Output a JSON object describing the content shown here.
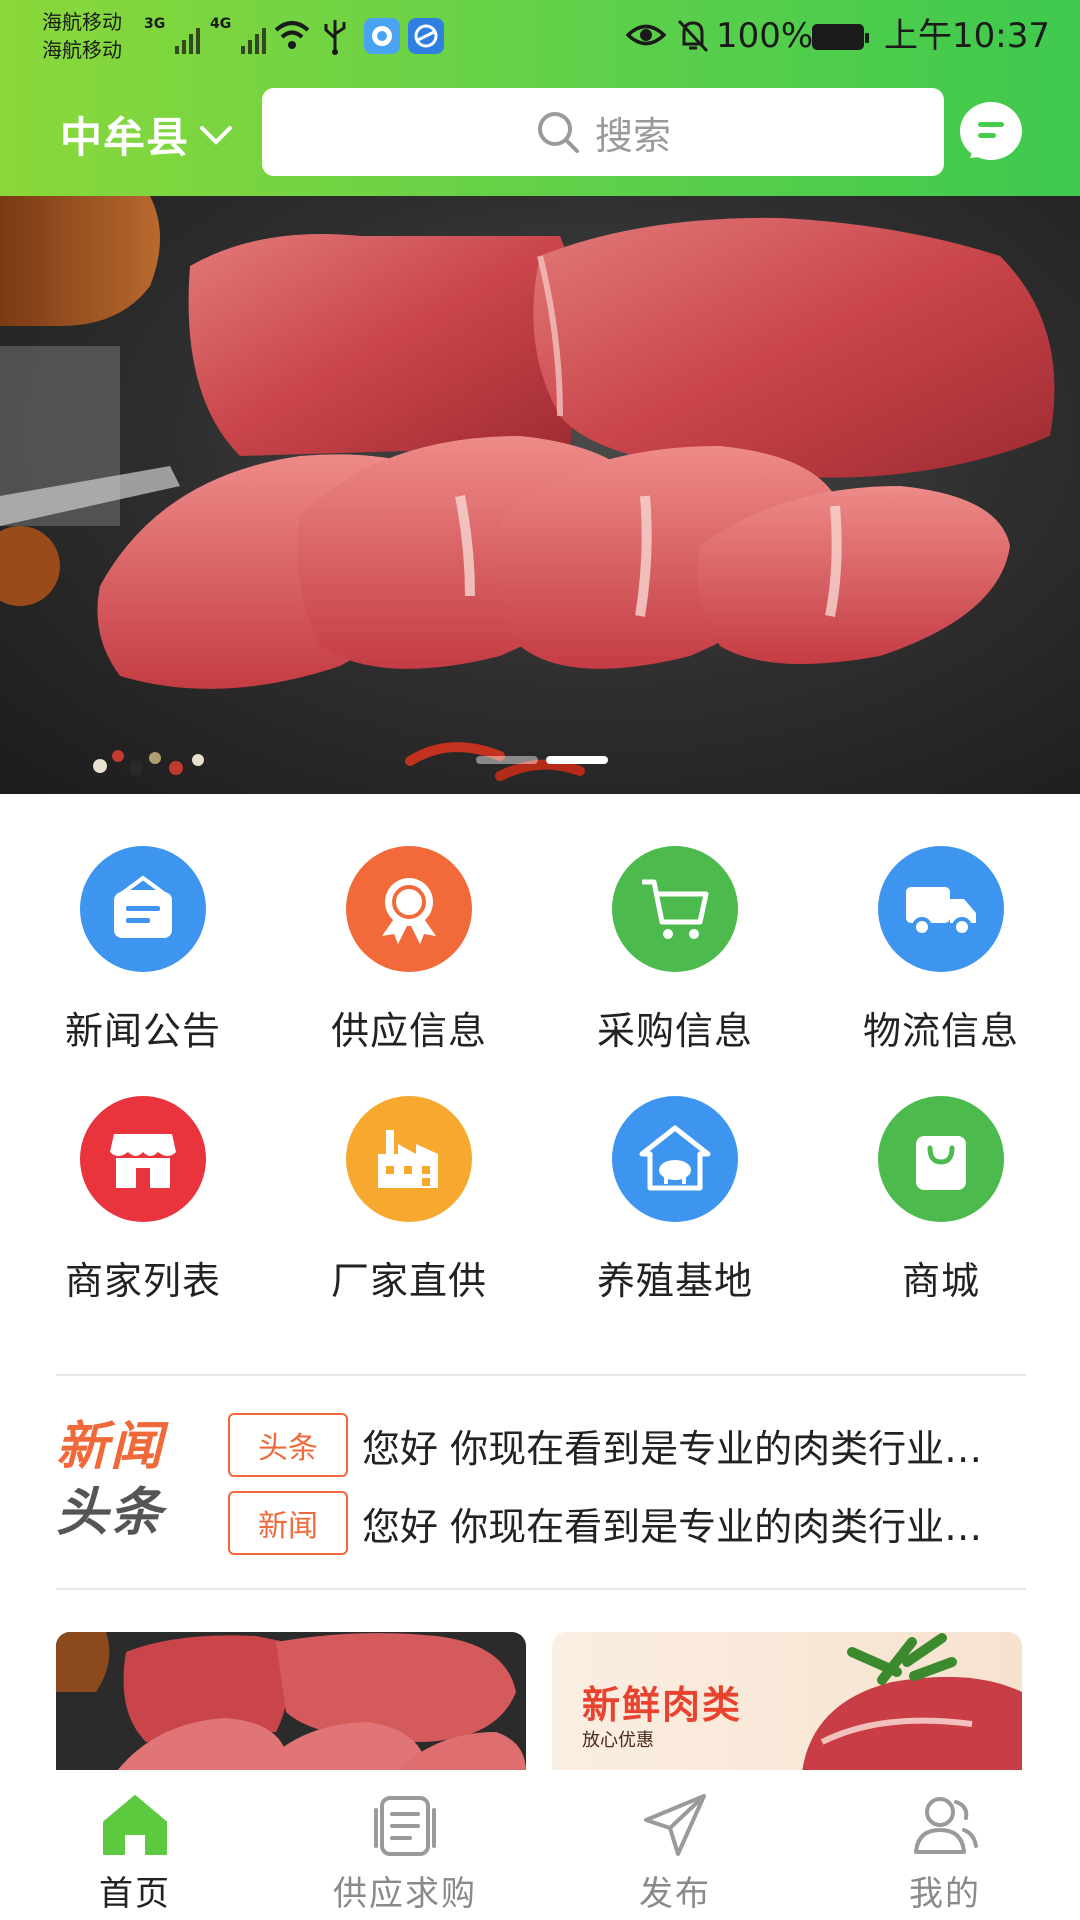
{
  "status_bar": {
    "carrier_1": "海航移动",
    "carrier_2": "海航移动",
    "network_1": "3G",
    "network_2": "4G",
    "battery": "100%",
    "time": "上午10:37"
  },
  "header": {
    "location": "中牟县",
    "search_placeholder": "搜索"
  },
  "banner": {
    "slide_count": 2,
    "active_slide": 2
  },
  "categories": [
    {
      "label": "新闻公告",
      "icon": "news-bag-icon",
      "color": "#3e95f0"
    },
    {
      "label": "供应信息",
      "icon": "award-ribbon-icon",
      "color": "#f26a3a"
    },
    {
      "label": "采购信息",
      "icon": "shopping-cart-icon",
      "color": "#4dba4e"
    },
    {
      "label": "物流信息",
      "icon": "delivery-truck-icon",
      "color": "#3e95f0"
    },
    {
      "label": "商家列表",
      "icon": "storefront-icon",
      "color": "#e9333d"
    },
    {
      "label": "厂家直供",
      "icon": "factory-icon",
      "color": "#f6a92e"
    },
    {
      "label": "养殖基地",
      "icon": "pig-farm-icon",
      "color": "#3e95f0"
    },
    {
      "label": "商城",
      "icon": "shopping-bag-icon",
      "color": "#4dba4e"
    }
  ],
  "news": {
    "logo_line1": "新闻",
    "logo_line2": "头条",
    "items": [
      {
        "tag": "头条",
        "text": "您好 你现在看到是专业的肉类行业信息平台"
      },
      {
        "tag": "新闻",
        "text": "您好 你现在看到是专业的肉类行业信息平台"
      }
    ]
  },
  "promos": {
    "right_title": "新鲜肉类",
    "right_subtitle": "放心优惠"
  },
  "tabbar": [
    {
      "label": "首页",
      "icon": "home-icon",
      "active": true
    },
    {
      "label": "供应求购",
      "icon": "document-list-icon",
      "active": false
    },
    {
      "label": "发布",
      "icon": "paper-plane-icon",
      "active": false
    },
    {
      "label": "我的",
      "icon": "user-profile-icon",
      "active": false
    }
  ],
  "colors": {
    "header_green": "#5fd04a",
    "accent_orange": "#f0693a",
    "tab_active": "#5cc93e"
  }
}
